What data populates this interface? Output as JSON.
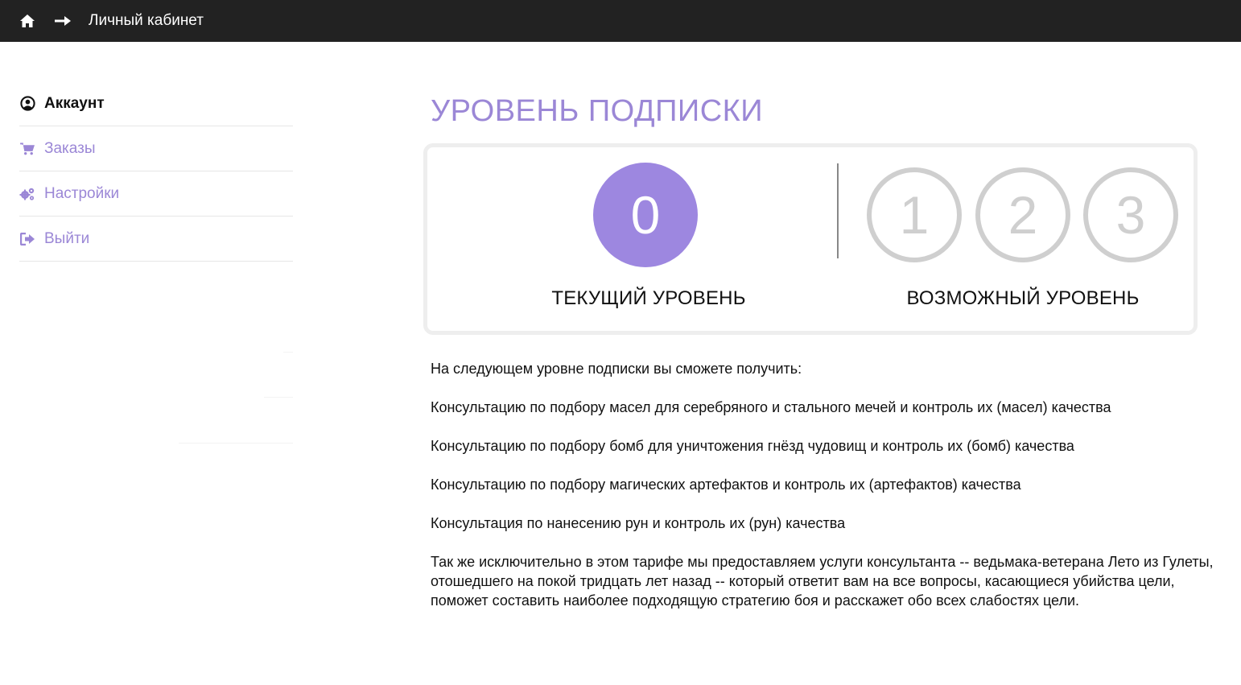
{
  "topbar": {
    "breadcrumb": "Личный кабинет",
    "home_icon": "home-icon",
    "arrow_icon": "arrow-right-icon",
    "background": "#222222"
  },
  "sidebar": {
    "items": [
      {
        "label": "Аккаунт",
        "icon": "user-circle-icon",
        "active": true
      },
      {
        "label": "Заказы",
        "icon": "shopping-cart-icon",
        "active": false
      },
      {
        "label": "Настройки",
        "icon": "gears-icon",
        "active": false
      },
      {
        "label": "Выйти",
        "icon": "sign-out-icon",
        "active": false
      }
    ]
  },
  "main": {
    "title": "УРОВЕНЬ ПОДПИСКИ",
    "current_level": {
      "value": "0",
      "caption": "ТЕКУЩИЙ УРОВЕНЬ"
    },
    "possible_levels": {
      "values": [
        "1",
        "2",
        "3"
      ],
      "caption": "ВОЗМОЖНЫЙ УРОВЕНЬ"
    },
    "description": [
      "На следующем уровне подписки вы сможете получить:",
      "Консультацию по подбору масел для серебряного и стального мечей и контроль их (масел) качества",
      "Консультацию по подбору бомб для уничтожения гнёзд чудовищ и контроль их (бомб) качества",
      "Консультацию по подбору магических артефактов и контроль их (артефактов) качества",
      "Консультация по нанесению рун и контроль их (рун) качества",
      "Так же исключительно в этом тарифе мы предоставляем услуги консультанта -- ведьмака-ветерана Лето из Гулеты, отошедшего на покой тридцать лет назад -- который ответит вам на все вопросы, касающиеся убийства цели, поможет составить наиболее подходящую стратегию боя и расскажет обо всех слабостях цели."
    ]
  },
  "colors": {
    "accent": "#9b87d6",
    "current_circle": "#9d87e0",
    "inactive_circle": "#cfcfcf"
  }
}
